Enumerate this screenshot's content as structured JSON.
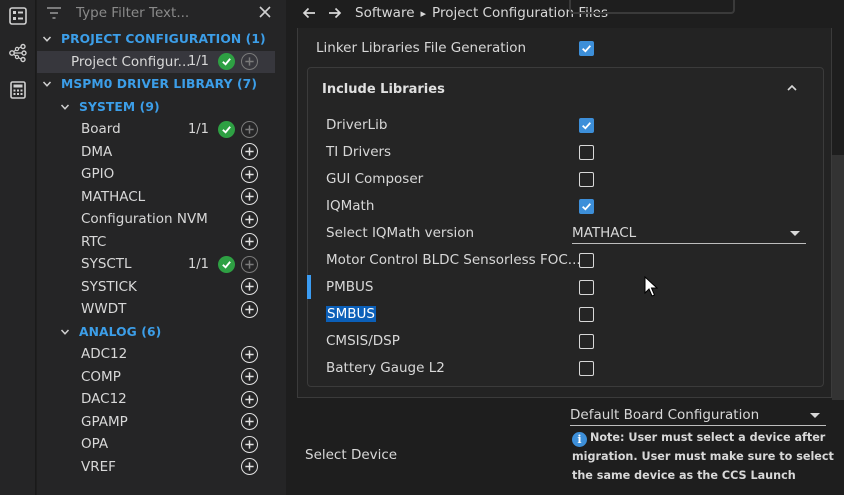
{
  "activity_bar": {
    "items": [
      {
        "icon": "list-panel-icon"
      },
      {
        "icon": "hierarchy-icon"
      },
      {
        "icon": "calculator-icon"
      }
    ]
  },
  "sidebar": {
    "filter": {
      "placeholder": "Type Filter Text..."
    },
    "tree": [
      {
        "kind": "category",
        "label": "PROJECT CONFIGURATION (1)",
        "level": 0
      },
      {
        "kind": "item",
        "label": "Project Configur...",
        "count": "1/1",
        "status": "ok",
        "level": 1,
        "selected": true
      },
      {
        "kind": "category",
        "label": "MSPM0 DRIVER LIBRARY (7)",
        "level": 0
      },
      {
        "kind": "category",
        "label": "SYSTEM (9)",
        "level": 1
      },
      {
        "kind": "item",
        "label": "Board",
        "count": "1/1",
        "status": "ok",
        "level": 2
      },
      {
        "kind": "item",
        "label": "DMA",
        "level": 2
      },
      {
        "kind": "item",
        "label": "GPIO",
        "level": 2
      },
      {
        "kind": "item",
        "label": "MATHACL",
        "level": 2
      },
      {
        "kind": "item",
        "label": "Configuration NVM",
        "level": 2
      },
      {
        "kind": "item",
        "label": "RTC",
        "level": 2
      },
      {
        "kind": "item",
        "label": "SYSCTL",
        "count": "1/1",
        "status": "ok",
        "level": 2
      },
      {
        "kind": "item",
        "label": "SYSTICK",
        "level": 2
      },
      {
        "kind": "item",
        "label": "WWDT",
        "level": 2
      },
      {
        "kind": "category",
        "label": "ANALOG (6)",
        "level": 1
      },
      {
        "kind": "item",
        "label": "ADC12",
        "level": 2
      },
      {
        "kind": "item",
        "label": "COMP",
        "level": 2
      },
      {
        "kind": "item",
        "label": "DAC12",
        "level": 2
      },
      {
        "kind": "item",
        "label": "GPAMP",
        "level": 2
      },
      {
        "kind": "item",
        "label": "OPA",
        "level": 2
      },
      {
        "kind": "item",
        "label": "VREF",
        "level": 2
      }
    ]
  },
  "breadcrumb": {
    "items": [
      "Software",
      "Project Configuration Files"
    ]
  },
  "main": {
    "linker_label": "Linker Libraries File Generation",
    "linker_checked": true,
    "group_title": "Include Libraries",
    "libraries": [
      {
        "label": "DriverLib",
        "checked": true
      },
      {
        "label": "TI Drivers",
        "checked": false
      },
      {
        "label": "GUI Composer",
        "checked": false
      },
      {
        "label": "IQMath",
        "checked": true
      },
      {
        "label": "Select IQMath version",
        "select": "MATHACL"
      },
      {
        "label": "Motor Control BLDC Sensorless FOC...",
        "checked": false
      },
      {
        "label": "PMBUS",
        "checked": false,
        "focused": true
      },
      {
        "label": "SMBUS",
        "checked": false,
        "highlighted": true
      },
      {
        "label": "CMSIS/DSP",
        "checked": false
      },
      {
        "label": "Battery Gauge L2",
        "checked": false
      }
    ],
    "board_select": "Default Board Configuration",
    "select_device_label": "Select Device",
    "note": "Note: User must select a device after migration. User must make sure to select the same device as the CCS Launch"
  },
  "colors": {
    "accent": "#3c9ee8",
    "checkbox": "#3d8fd9",
    "ok_green": "#2ea043",
    "selection": "#0b5fb8"
  }
}
